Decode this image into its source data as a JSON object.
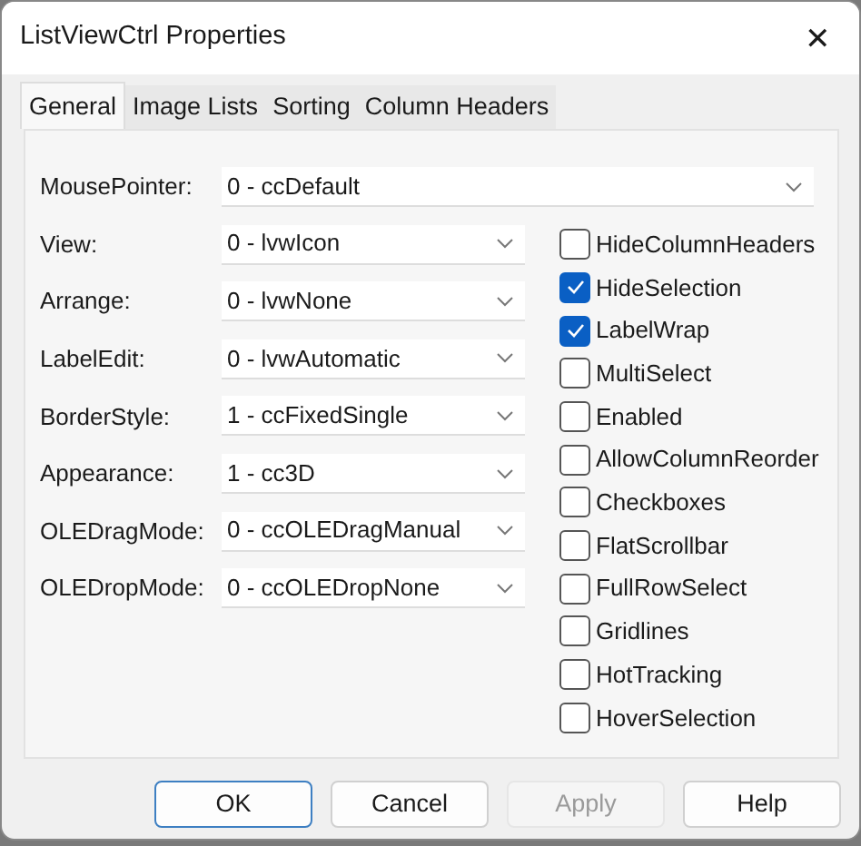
{
  "window": {
    "title": "ListViewCtrl Properties",
    "close": "✕"
  },
  "tabs": [
    {
      "label": "General",
      "selected": true
    },
    {
      "label": "Image Lists",
      "selected": false
    },
    {
      "label": "Sorting",
      "selected": false
    },
    {
      "label": "Column Headers",
      "selected": false
    }
  ],
  "mouse_pointer": {
    "label": "MousePointer:",
    "value": "0 - ccDefault"
  },
  "properties": [
    {
      "label": "View:",
      "value": "0 - lvwIcon"
    },
    {
      "label": "Arrange:",
      "value": "0 - lvwNone"
    },
    {
      "label": "LabelEdit:",
      "value": "0 - lvwAutomatic"
    },
    {
      "label": "BorderStyle:",
      "value": "1 - ccFixedSingle"
    },
    {
      "label": "Appearance:",
      "value": "1 - cc3D"
    },
    {
      "label": "OLEDragMode:",
      "value": "0 - ccOLEDragManual"
    },
    {
      "label": "OLEDropMode:",
      "value": "0 - ccOLEDropNone"
    }
  ],
  "options": [
    {
      "label": "HideColumnHeaders",
      "checked": false
    },
    {
      "label": "HideSelection",
      "checked": true
    },
    {
      "label": "LabelWrap",
      "checked": true
    },
    {
      "label": "MultiSelect",
      "checked": false
    },
    {
      "label": "Enabled",
      "checked": false
    },
    {
      "label": "AllowColumnReorder",
      "checked": false
    },
    {
      "label": "Checkboxes",
      "checked": false
    },
    {
      "label": "FlatScrollbar",
      "checked": false
    },
    {
      "label": "FullRowSelect",
      "checked": false
    },
    {
      "label": "Gridlines",
      "checked": false
    },
    {
      "label": "HotTracking",
      "checked": false
    },
    {
      "label": "HoverSelection",
      "checked": false
    }
  ],
  "buttons": [
    {
      "label": "OK",
      "default": true,
      "disabled": false
    },
    {
      "label": "Cancel",
      "default": false,
      "disabled": false
    },
    {
      "label": "Apply",
      "default": false,
      "disabled": true
    },
    {
      "label": "Help",
      "default": false,
      "disabled": false
    }
  ]
}
